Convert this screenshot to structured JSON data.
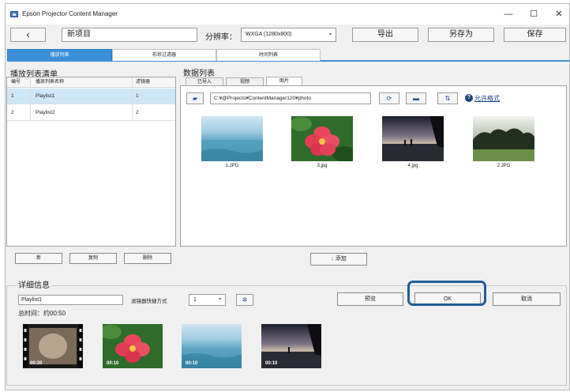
{
  "window": {
    "title": "Epson Projector Content Manager",
    "minimize_glyph": "—",
    "maximize_glyph": "☐",
    "close_glyph": "✕"
  },
  "toolbar": {
    "back_glyph": "‹",
    "project_name": "新项目",
    "resolution_label": "分辨率：",
    "resolution_value": "WXGA (1280x800)",
    "export_label": "导出",
    "save_as_label": "另存为",
    "save_label": "保存"
  },
  "main_tabs": [
    {
      "label": "播放列表",
      "active": true
    },
    {
      "label": "形状过滤器",
      "active": false
    },
    {
      "label": "时间列表",
      "active": false
    }
  ],
  "playlist_panel": {
    "title": "播放列表清单",
    "columns": [
      "编号",
      "播放列表名称",
      "滤镜器"
    ],
    "rows": [
      {
        "num": "1",
        "name": "Playlist1",
        "filter": "1",
        "selected": true
      },
      {
        "num": "2",
        "name": "Playlist2",
        "filter": "2",
        "selected": false
      }
    ],
    "new_label": "新",
    "copy_label": "复制",
    "delete_label": "删除"
  },
  "data_panel": {
    "title": "数据列表",
    "tabs": [
      {
        "label": "已导入",
        "active": false
      },
      {
        "label": "视频",
        "active": false
      },
      {
        "label": "图片",
        "active": true
      }
    ],
    "path": "C:¥@Projects¥ContentManager120¥photo",
    "formats_link": "允许格式",
    "add_label": "添加",
    "images": [
      {
        "name": "1.JPG",
        "scene": "sea"
      },
      {
        "name": "3.jpg",
        "scene": "flower"
      },
      {
        "name": "4.jpg",
        "scene": "sunset"
      },
      {
        "name": "2.JPG",
        "scene": "trees"
      }
    ]
  },
  "details": {
    "title": "详细信息",
    "playlist_name": "Playlist1",
    "filter_mode_label": "滤镜器快捷方式",
    "filter_mode_value": "1",
    "total_time": "总时间：约00:50",
    "preview_label": "预览",
    "ok_label": "OK",
    "cancel_label": "取消",
    "timeline": [
      {
        "duration": "00:20",
        "scene": "video"
      },
      {
        "duration": "00:10",
        "scene": "flower"
      },
      {
        "duration": "00:10",
        "scene": "sea"
      },
      {
        "duration": "00:10",
        "scene": "sunset"
      }
    ]
  },
  "colors": {
    "active_tab": "#3a8fd8",
    "selection": "#cfe6f7",
    "highlight_ring": "#1f5d99"
  }
}
